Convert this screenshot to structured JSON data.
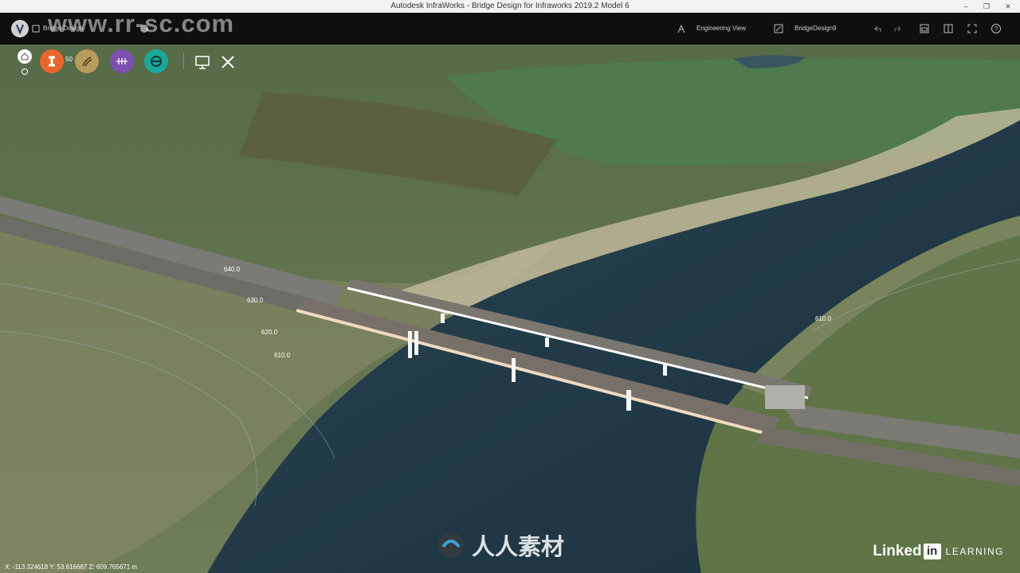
{
  "window": {
    "title": "Autodesk InfraWorks - Bridge Design for Infraworks 2019.2 Model 6",
    "minimize": "–",
    "maximize": "❐",
    "close": "✕"
  },
  "appbar": {
    "model_name": "Bridge Design",
    "view_label": "Engineering View",
    "proposal_label": "BridgeDesign9"
  },
  "toolbar": {
    "badge_text": "50",
    "tools": [
      {
        "name": "structures-tool",
        "color": "#e8662c"
      },
      {
        "name": "roads-tool",
        "color": "#b89a5a"
      },
      {
        "name": "profile-tool",
        "color": "#7c4fb0"
      },
      {
        "name": "drainage-tool",
        "color": "#1aa89a"
      }
    ]
  },
  "stations": [
    "640.0",
    "630.0",
    "620.0",
    "610.0",
    "610.0"
  ],
  "status": {
    "coordinates": "X: -113.324618 Y: 53.616687 Z: 609.765671 m"
  },
  "branding": {
    "linkedin": "Linked",
    "in": "in",
    "learning": "LEARNING"
  },
  "watermark": {
    "url": "www.rr-sc.com",
    "center_text": "人人素材"
  }
}
